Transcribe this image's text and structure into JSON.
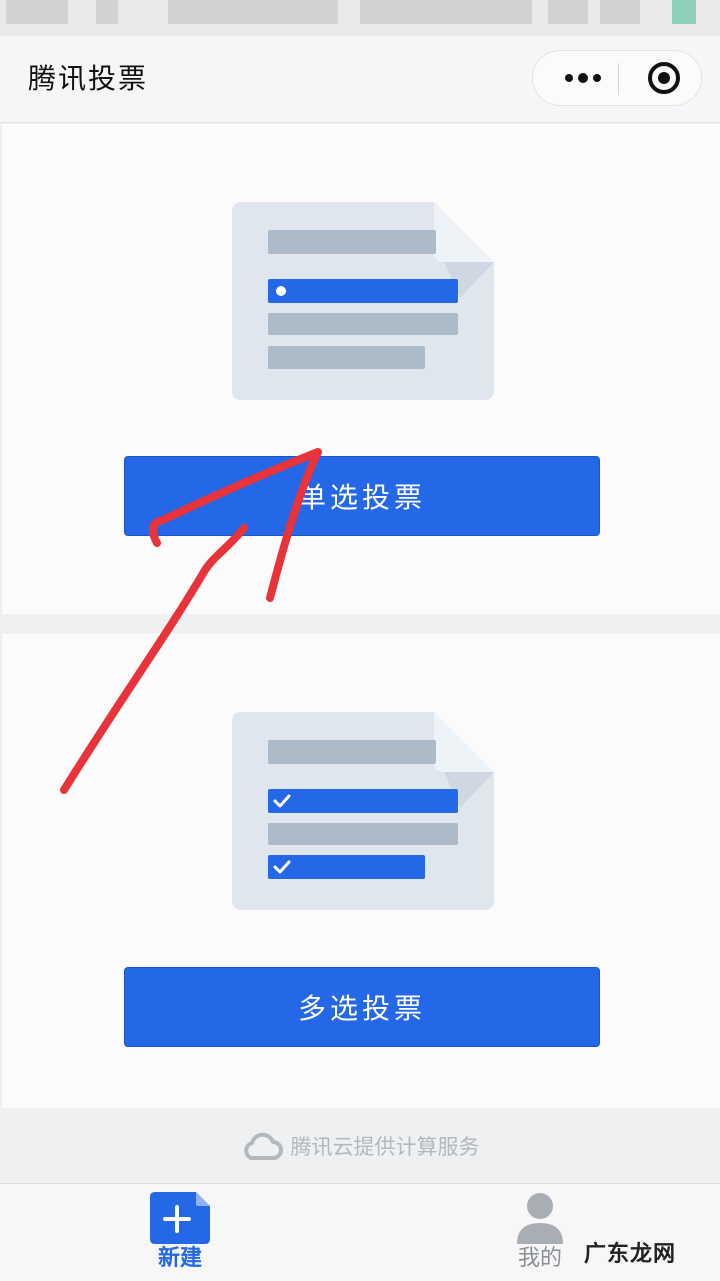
{
  "navbar": {
    "title": "腾讯投票"
  },
  "capsule": {
    "more_icon": "more-dots-icon",
    "close_icon": "target-circle-icon"
  },
  "cards": [
    {
      "button_label": "单选投票",
      "illustration_icon": "single-choice-document-icon"
    },
    {
      "button_label": "多选投票",
      "illustration_icon": "multi-choice-document-icon"
    }
  ],
  "footer": {
    "credit": "腾讯云提供计算服务",
    "icon": "cloud-icon"
  },
  "tabbar": {
    "items": [
      {
        "label": "新建",
        "icon": "add-document-icon",
        "active": true
      },
      {
        "label": "我的",
        "icon": "user-icon",
        "active": false
      }
    ]
  },
  "watermark": "广东龙网",
  "colors": {
    "accent": "#2468e8",
    "annotation": "#e8333a",
    "placeholder_bar": "#adbac8"
  }
}
